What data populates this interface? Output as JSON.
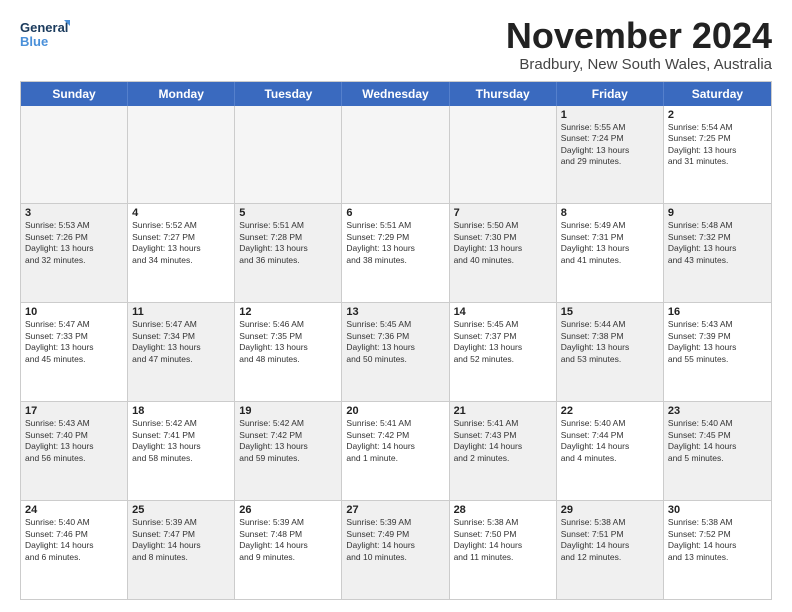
{
  "logo": {
    "line1": "General",
    "line2": "Blue"
  },
  "title": "November 2024",
  "location": "Bradbury, New South Wales, Australia",
  "header_days": [
    "Sunday",
    "Monday",
    "Tuesday",
    "Wednesday",
    "Thursday",
    "Friday",
    "Saturday"
  ],
  "rows": [
    [
      {
        "day": "",
        "text": "",
        "empty": true
      },
      {
        "day": "",
        "text": "",
        "empty": true
      },
      {
        "day": "",
        "text": "",
        "empty": true
      },
      {
        "day": "",
        "text": "",
        "empty": true
      },
      {
        "day": "",
        "text": "",
        "empty": true
      },
      {
        "day": "1",
        "text": "Sunrise: 5:55 AM\nSunset: 7:24 PM\nDaylight: 13 hours\nand 29 minutes.",
        "shaded": true
      },
      {
        "day": "2",
        "text": "Sunrise: 5:54 AM\nSunset: 7:25 PM\nDaylight: 13 hours\nand 31 minutes.",
        "shaded": false
      }
    ],
    [
      {
        "day": "3",
        "text": "Sunrise: 5:53 AM\nSunset: 7:26 PM\nDaylight: 13 hours\nand 32 minutes.",
        "shaded": true
      },
      {
        "day": "4",
        "text": "Sunrise: 5:52 AM\nSunset: 7:27 PM\nDaylight: 13 hours\nand 34 minutes.",
        "shaded": false
      },
      {
        "day": "5",
        "text": "Sunrise: 5:51 AM\nSunset: 7:28 PM\nDaylight: 13 hours\nand 36 minutes.",
        "shaded": true
      },
      {
        "day": "6",
        "text": "Sunrise: 5:51 AM\nSunset: 7:29 PM\nDaylight: 13 hours\nand 38 minutes.",
        "shaded": false
      },
      {
        "day": "7",
        "text": "Sunrise: 5:50 AM\nSunset: 7:30 PM\nDaylight: 13 hours\nand 40 minutes.",
        "shaded": true
      },
      {
        "day": "8",
        "text": "Sunrise: 5:49 AM\nSunset: 7:31 PM\nDaylight: 13 hours\nand 41 minutes.",
        "shaded": false
      },
      {
        "day": "9",
        "text": "Sunrise: 5:48 AM\nSunset: 7:32 PM\nDaylight: 13 hours\nand 43 minutes.",
        "shaded": true
      }
    ],
    [
      {
        "day": "10",
        "text": "Sunrise: 5:47 AM\nSunset: 7:33 PM\nDaylight: 13 hours\nand 45 minutes.",
        "shaded": false
      },
      {
        "day": "11",
        "text": "Sunrise: 5:47 AM\nSunset: 7:34 PM\nDaylight: 13 hours\nand 47 minutes.",
        "shaded": true
      },
      {
        "day": "12",
        "text": "Sunrise: 5:46 AM\nSunset: 7:35 PM\nDaylight: 13 hours\nand 48 minutes.",
        "shaded": false
      },
      {
        "day": "13",
        "text": "Sunrise: 5:45 AM\nSunset: 7:36 PM\nDaylight: 13 hours\nand 50 minutes.",
        "shaded": true
      },
      {
        "day": "14",
        "text": "Sunrise: 5:45 AM\nSunset: 7:37 PM\nDaylight: 13 hours\nand 52 minutes.",
        "shaded": false
      },
      {
        "day": "15",
        "text": "Sunrise: 5:44 AM\nSunset: 7:38 PM\nDaylight: 13 hours\nand 53 minutes.",
        "shaded": true
      },
      {
        "day": "16",
        "text": "Sunrise: 5:43 AM\nSunset: 7:39 PM\nDaylight: 13 hours\nand 55 minutes.",
        "shaded": false
      }
    ],
    [
      {
        "day": "17",
        "text": "Sunrise: 5:43 AM\nSunset: 7:40 PM\nDaylight: 13 hours\nand 56 minutes.",
        "shaded": true
      },
      {
        "day": "18",
        "text": "Sunrise: 5:42 AM\nSunset: 7:41 PM\nDaylight: 13 hours\nand 58 minutes.",
        "shaded": false
      },
      {
        "day": "19",
        "text": "Sunrise: 5:42 AM\nSunset: 7:42 PM\nDaylight: 13 hours\nand 59 minutes.",
        "shaded": true
      },
      {
        "day": "20",
        "text": "Sunrise: 5:41 AM\nSunset: 7:42 PM\nDaylight: 14 hours\nand 1 minute.",
        "shaded": false
      },
      {
        "day": "21",
        "text": "Sunrise: 5:41 AM\nSunset: 7:43 PM\nDaylight: 14 hours\nand 2 minutes.",
        "shaded": true
      },
      {
        "day": "22",
        "text": "Sunrise: 5:40 AM\nSunset: 7:44 PM\nDaylight: 14 hours\nand 4 minutes.",
        "shaded": false
      },
      {
        "day": "23",
        "text": "Sunrise: 5:40 AM\nSunset: 7:45 PM\nDaylight: 14 hours\nand 5 minutes.",
        "shaded": true
      }
    ],
    [
      {
        "day": "24",
        "text": "Sunrise: 5:40 AM\nSunset: 7:46 PM\nDaylight: 14 hours\nand 6 minutes.",
        "shaded": false
      },
      {
        "day": "25",
        "text": "Sunrise: 5:39 AM\nSunset: 7:47 PM\nDaylight: 14 hours\nand 8 minutes.",
        "shaded": true
      },
      {
        "day": "26",
        "text": "Sunrise: 5:39 AM\nSunset: 7:48 PM\nDaylight: 14 hours\nand 9 minutes.",
        "shaded": false
      },
      {
        "day": "27",
        "text": "Sunrise: 5:39 AM\nSunset: 7:49 PM\nDaylight: 14 hours\nand 10 minutes.",
        "shaded": true
      },
      {
        "day": "28",
        "text": "Sunrise: 5:38 AM\nSunset: 7:50 PM\nDaylight: 14 hours\nand 11 minutes.",
        "shaded": false
      },
      {
        "day": "29",
        "text": "Sunrise: 5:38 AM\nSunset: 7:51 PM\nDaylight: 14 hours\nand 12 minutes.",
        "shaded": true
      },
      {
        "day": "30",
        "text": "Sunrise: 5:38 AM\nSunset: 7:52 PM\nDaylight: 14 hours\nand 13 minutes.",
        "shaded": false
      }
    ]
  ]
}
